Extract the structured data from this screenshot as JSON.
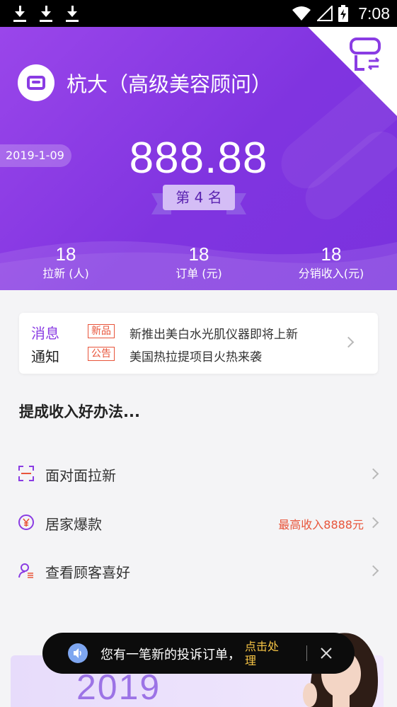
{
  "status_bar": {
    "icons": [
      "download-icon",
      "download-icon",
      "download-icon",
      "wifi-icon",
      "signal-icon",
      "battery-charging-icon"
    ],
    "time": "7:08"
  },
  "header": {
    "user_name": "杭大（高级美容顾问）",
    "date": "2019-1-09",
    "score": "888.88",
    "rank": "第 4 名",
    "stats": [
      {
        "value": "18",
        "label": "拉新 (人)"
      },
      {
        "value": "18",
        "label": "订单 (元)"
      },
      {
        "value": "18",
        "label": "分销收入(元)"
      }
    ],
    "accent_color": "#8a3ce3"
  },
  "notice": {
    "title_line1": "消息",
    "title_line2": "通知",
    "items": [
      {
        "tag": "新品",
        "text": "新推出美白水光肌仪器即将上新"
      },
      {
        "tag": "公告",
        "text": "美国热拉提项目火热来袭"
      }
    ]
  },
  "tips": {
    "title": "提成收入好办法...",
    "items": [
      {
        "label": "面对面拉新",
        "icon": "scan-icon",
        "extra": ""
      },
      {
        "label": "居家爆款",
        "icon": "yen-icon",
        "extra": "最高收入8888元"
      },
      {
        "label": "查看顾客喜好",
        "icon": "customer-icon",
        "extra": ""
      }
    ]
  },
  "banner": {
    "year": "2019"
  },
  "toast": {
    "message": "您有一笔新的投诉订单，",
    "action": "点击处理"
  }
}
